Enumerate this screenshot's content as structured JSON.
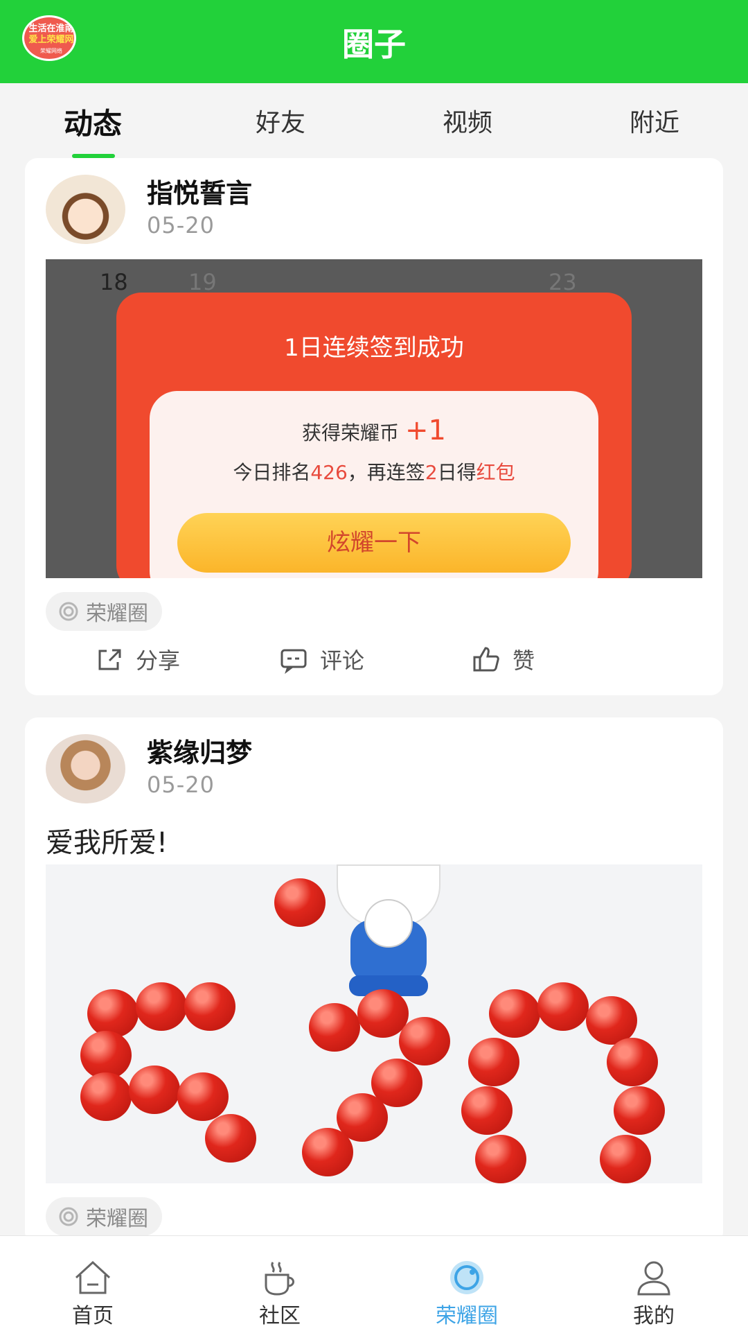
{
  "header": {
    "title": "圈子",
    "logo_lines": [
      "生活在淮南",
      "爱上荣耀网",
      "荣耀网络"
    ]
  },
  "tabs": [
    {
      "label": "动态",
      "active": true
    },
    {
      "label": "好友",
      "active": false
    },
    {
      "label": "视频",
      "active": false
    },
    {
      "label": "附近",
      "active": false
    }
  ],
  "posts": [
    {
      "username": "指悦誓言",
      "date": "05-20",
      "text": "",
      "image": {
        "bg_numbers": [
          "18",
          "19",
          "23"
        ],
        "dialog": {
          "title": "1日连续签到成功",
          "reward_prefix": "获得荣耀币",
          "reward_value": "+1",
          "rank_prefix": "今日排名",
          "rank_value": "426",
          "rank_mid": "，再连签",
          "days_value": "2",
          "days_suffix": "日得",
          "prize": "红包",
          "button": "炫耀一下"
        }
      },
      "tag": "荣耀圈",
      "actions": {
        "share": "分享",
        "comment": "评论",
        "like": "赞"
      }
    },
    {
      "username": "紫缘归梦",
      "date": "05-20",
      "text": "爱我所爱!",
      "image": {
        "description_icon": "520-apples-cat"
      },
      "tag": "荣耀圈"
    }
  ],
  "bottom_nav": [
    {
      "label": "首页",
      "icon": "home-icon",
      "active": false
    },
    {
      "label": "社区",
      "icon": "coffee-icon",
      "active": false
    },
    {
      "label": "荣耀圈",
      "icon": "circle-icon",
      "active": true
    },
    {
      "label": "我的",
      "icon": "user-icon",
      "active": false
    }
  ],
  "colors": {
    "brand_green": "#22d13a",
    "active_blue": "#3ea4e6",
    "dialog_red": "#f04a2e"
  }
}
